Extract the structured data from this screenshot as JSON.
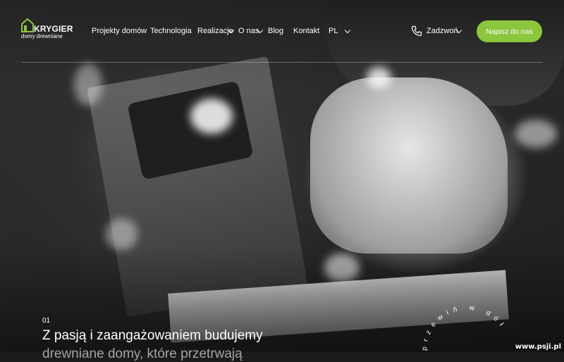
{
  "logo": {
    "name": "KRYGIER",
    "tagline": "domy drewniane"
  },
  "nav": {
    "items": [
      {
        "label": "Projekty domów"
      },
      {
        "label": "Technologia"
      },
      {
        "label": "Realizacje"
      },
      {
        "label": "O nas"
      },
      {
        "label": "Blog"
      },
      {
        "label": "Kontakt"
      }
    ],
    "language": "PL"
  },
  "call": {
    "label": "Zadzwoń"
  },
  "cta": {
    "label": "Napisz do nas"
  },
  "hero": {
    "slide_number": "01",
    "headline": "Z pasją i zaangażowaniem budujemy",
    "headline_line2": "drewniane domy, które przetrwają"
  },
  "scroll_hint": {
    "text": "przewiń w dół"
  },
  "watermark": "www.psji.pl",
  "colors": {
    "accent": "#8cc63f"
  },
  "icons": {
    "logo": "house-icon",
    "phone": "phone-icon",
    "dropdown": "chevron-down-icon"
  }
}
